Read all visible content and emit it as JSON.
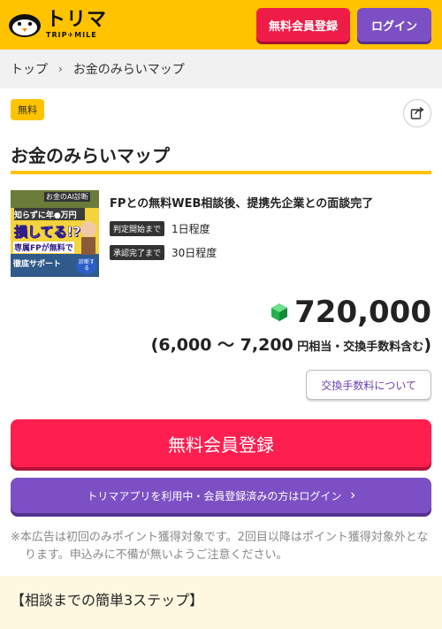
{
  "header": {
    "logo_jp": "トリマ",
    "logo_en": "TRIP✈MILE",
    "register_label": "無料会員登録",
    "login_label": "ログイン"
  },
  "breadcrumb": {
    "home": "トップ",
    "separator": "›",
    "current": "お金のみらいマップ"
  },
  "offer": {
    "badge": "無料",
    "title": "お金のみらいマップ",
    "thumb_text_1": "お金のAI診断",
    "thumb_text_2": "知らずに年●万円",
    "thumb_text_3": "損してる!?",
    "thumb_text_4": "専属FPが無料で",
    "thumb_text_5": "徹底サポート",
    "thumb_text_6": "診断する",
    "condition": "FPとの無料WEB相談後、提携先企業との面談完了",
    "steps": [
      {
        "tag": "判定開始まで",
        "value": "1日程度"
      },
      {
        "tag": "承認完了まで",
        "value": "30日程度"
      }
    ]
  },
  "points": {
    "amount": "720,000",
    "range_open": "(",
    "range_value": "6,000 〜 7,200",
    "range_suffix": " 円相当・交換手数料含む",
    "range_close": ")"
  },
  "fee_button": "交換手数料について",
  "register_button": "無料会員登録",
  "app_login_button": "トリマアプリを利用中・会員登録済みの方はログイン",
  "app_login_chevron": "›",
  "notice": "※本広告は初回のみポイント獲得対象です。2回目以降はポイント獲得対象外となります。申込みに不備が無いようご注意ください。",
  "steps_heading": "【相談までの簡単3ステップ】",
  "colors": {
    "brand_yellow": "#ffc300",
    "register_red": "#ee1c47",
    "login_purple": "#7c4fc4"
  }
}
